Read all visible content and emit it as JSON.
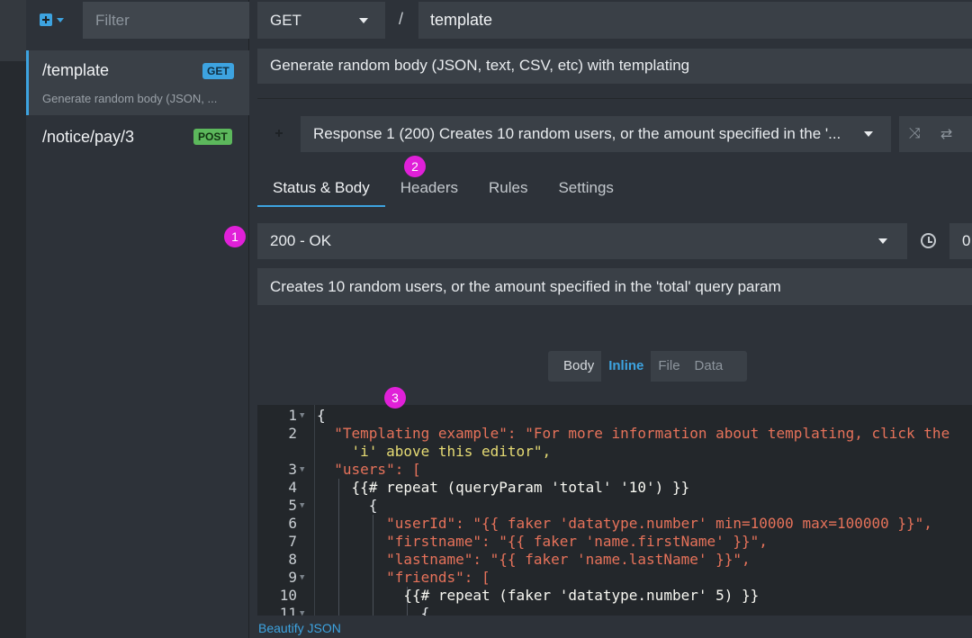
{
  "sidebar": {
    "filter_placeholder": "Filter",
    "routes": [
      {
        "path": "/template",
        "method": "GET",
        "description": "Generate random body (JSON, ..."
      },
      {
        "path": "/notice/pay/3",
        "method": "POST"
      }
    ]
  },
  "request": {
    "method": "GET",
    "separator": "/",
    "endpoint": "template",
    "description": "Generate random body (JSON, text, CSV, etc) with templating"
  },
  "response": {
    "selector_label": "Response 1 (200)   Creates 10 random users, or the amount specified in the '...",
    "tabs": [
      "Status & Body",
      "Headers",
      "Rules",
      "Settings"
    ],
    "active_tab": "Status & Body",
    "status": "200 - OK",
    "latency": "0",
    "description": "Creates 10 random users, or the amount specified in the 'total' query param",
    "body_toggle": {
      "label": "Body",
      "options": [
        "Inline",
        "File",
        "Data"
      ],
      "active": "Inline"
    }
  },
  "editor": {
    "line_numbers": [
      "1",
      "2",
      "",
      "3",
      "4",
      "5",
      "6",
      "7",
      "8",
      "9",
      "10",
      "11"
    ],
    "lines": [
      "{",
      "  \"Templating example\": \"For more information about templating, click the",
      "    'i' above this editor\",",
      "  \"users\": [",
      "    {{# repeat (queryParam 'total' '10') }}",
      "      {",
      "        \"userId\": \"{{ faker 'datatype.number' min=10000 max=100000 }}\",",
      "        \"firstname\": \"{{ faker 'name.firstName' }}\",",
      "        \"lastname\": \"{{ faker 'name.lastName' }}\",",
      "        \"friends\": [",
      "          {{# repeat (faker 'datatype.number' 5) }}",
      "            {"
    ],
    "beautify_label": "Beautify JSON"
  },
  "markers": [
    "1",
    "2",
    "3"
  ],
  "colors": {
    "accent": "#3da3e0",
    "get_badge": "#3da3e0",
    "post_badge": "#5cb85c",
    "marker": "#e020d8"
  }
}
